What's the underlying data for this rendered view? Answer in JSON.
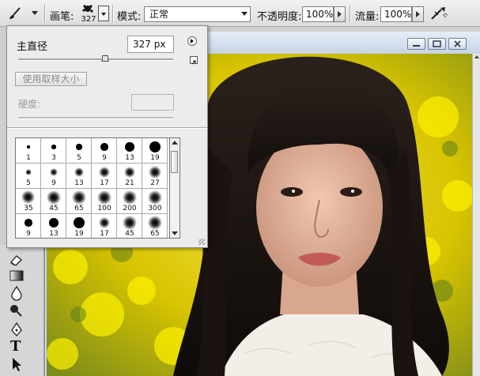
{
  "options_bar": {
    "tool_preset_icon": "brush-icon",
    "brush_label": "画笔:",
    "brush_size": "327",
    "mode_label": "模式:",
    "mode_value": "正常",
    "opacity_label": "不透明度:",
    "opacity_value": "100%",
    "flow_label": "流量:",
    "flow_value": "100%",
    "airbrush_icon": "airbrush-icon"
  },
  "brush_picker": {
    "master_diameter_label": "主直径",
    "master_diameter_value": "327 px",
    "master_diameter_percent": 0.56,
    "use_sample_size_label": "使用取样大小",
    "hardness_label": "硬度:",
    "hardness_value": "",
    "presets": [
      {
        "size": "1",
        "soft": false
      },
      {
        "size": "3",
        "soft": false
      },
      {
        "size": "5",
        "soft": false
      },
      {
        "size": "9",
        "soft": false
      },
      {
        "size": "13",
        "soft": false
      },
      {
        "size": "19",
        "soft": false
      },
      {
        "size": "5",
        "soft": true
      },
      {
        "size": "9",
        "soft": true
      },
      {
        "size": "13",
        "soft": true
      },
      {
        "size": "17",
        "soft": true
      },
      {
        "size": "21",
        "soft": true
      },
      {
        "size": "27",
        "soft": true
      },
      {
        "size": "35",
        "soft": true
      },
      {
        "size": "45",
        "soft": true
      },
      {
        "size": "65",
        "soft": true
      },
      {
        "size": "100",
        "soft": true
      },
      {
        "size": "200",
        "soft": true
      },
      {
        "size": "300",
        "soft": true
      },
      {
        "size": "9",
        "soft": false
      },
      {
        "size": "13",
        "soft": false
      },
      {
        "size": "19",
        "soft": false
      },
      {
        "size": "17",
        "soft": true
      },
      {
        "size": "45",
        "soft": true
      },
      {
        "size": "65",
        "soft": true
      }
    ]
  },
  "toolbox": {
    "tools": [
      "eraser-icon",
      "gradient-icon",
      "blur-drop-icon",
      "dodge-icon",
      "pen-icon",
      "type-icon",
      "path-select-icon"
    ],
    "type_tool_glyph": "T"
  },
  "document": {
    "minimize_icon": "minimize-icon",
    "maximize_icon": "maximize-icon",
    "close_icon": "close-icon"
  },
  "colors": {
    "background_field": "#e9d300",
    "hair": "#1b1411",
    "skin": "#e2b79d",
    "lips": "#c25b57"
  }
}
